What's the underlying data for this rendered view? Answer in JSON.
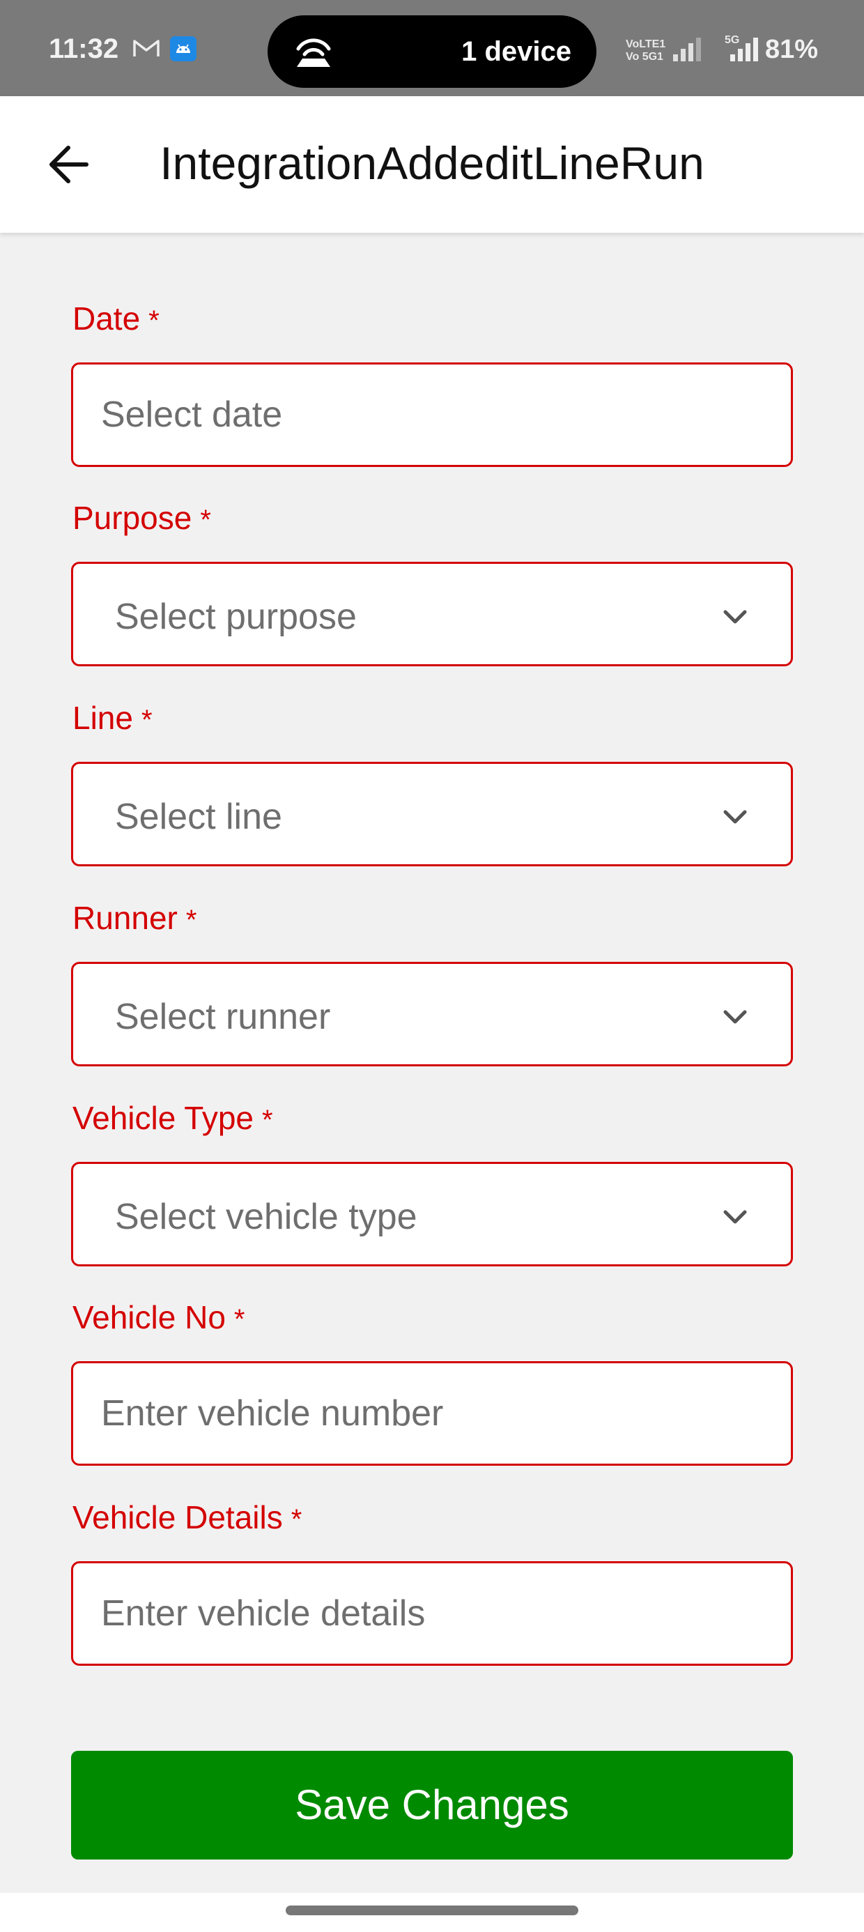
{
  "status_bar": {
    "time": "11:32",
    "hotspot_text": "1 device",
    "sim1_label_top": "VoLTE1",
    "sim1_label_bottom": "Vo 5G1",
    "sim2_label": "5G",
    "battery": "81%",
    "icons": [
      "gmail-icon",
      "android-icon",
      "hotspot-icon",
      "signal-icon",
      "signal-icon"
    ]
  },
  "app_bar": {
    "title": "IntegrationAddeditLineRun",
    "back_icon": "arrow-left-icon"
  },
  "form": {
    "fields": [
      {
        "label": "Date",
        "required": "*",
        "type": "input",
        "placeholder": "Select date"
      },
      {
        "label": "Purpose",
        "required": "*",
        "type": "select",
        "placeholder": "Select purpose"
      },
      {
        "label": "Line",
        "required": "*",
        "type": "select",
        "placeholder": "Select line"
      },
      {
        "label": "Runner",
        "required": "*",
        "type": "select",
        "placeholder": "Select runner"
      },
      {
        "label": "Vehicle Type",
        "required": "*",
        "type": "select",
        "placeholder": "Select vehicle type"
      },
      {
        "label": "Vehicle No",
        "required": "*",
        "type": "input",
        "placeholder": "Enter vehicle number"
      },
      {
        "label": "Vehicle Details",
        "required": "*",
        "type": "input",
        "placeholder": "Enter vehicle details"
      }
    ]
  },
  "save_button": {
    "label": "Save Changes"
  },
  "colors": {
    "accent_red": "#d40000",
    "save_green": "#008a00",
    "background": "#f2f1f2"
  }
}
